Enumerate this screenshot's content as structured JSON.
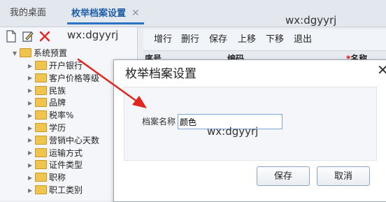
{
  "tabs": {
    "home_label": "我的桌面",
    "active_label": "枚举档案设置",
    "close_glyph": "✕"
  },
  "watermark": "wx:dgyyrj",
  "left_toolbar": {
    "icons": [
      "new-document-icon",
      "edit-icon",
      "delete-icon"
    ],
    "delete_color": "#e02a2a"
  },
  "tree": {
    "root": "系统预置",
    "items": [
      "开户银行",
      "客户价格等级",
      "民族",
      "品牌",
      "税率%",
      "学历",
      "营销中心天数",
      "运输方式",
      "证件类型",
      "职称",
      "职工类别"
    ]
  },
  "main_toolbar": {
    "buttons": [
      "增行",
      "删行",
      "保存",
      "上移",
      "下移",
      "退出"
    ]
  },
  "grid": {
    "col_seq": "序号",
    "col_code": "编码",
    "col_name": "名称",
    "required_mark": "*"
  },
  "dialog": {
    "title": "枚举档案设置",
    "close_glyph": "✕",
    "field_label": "档案名称",
    "field_value": "颜色",
    "save_label": "保存",
    "cancel_label": "取消"
  },
  "colors": {
    "accent": "#2b73c6",
    "arrow": "#e0261f",
    "folder": "#f0c44f"
  }
}
